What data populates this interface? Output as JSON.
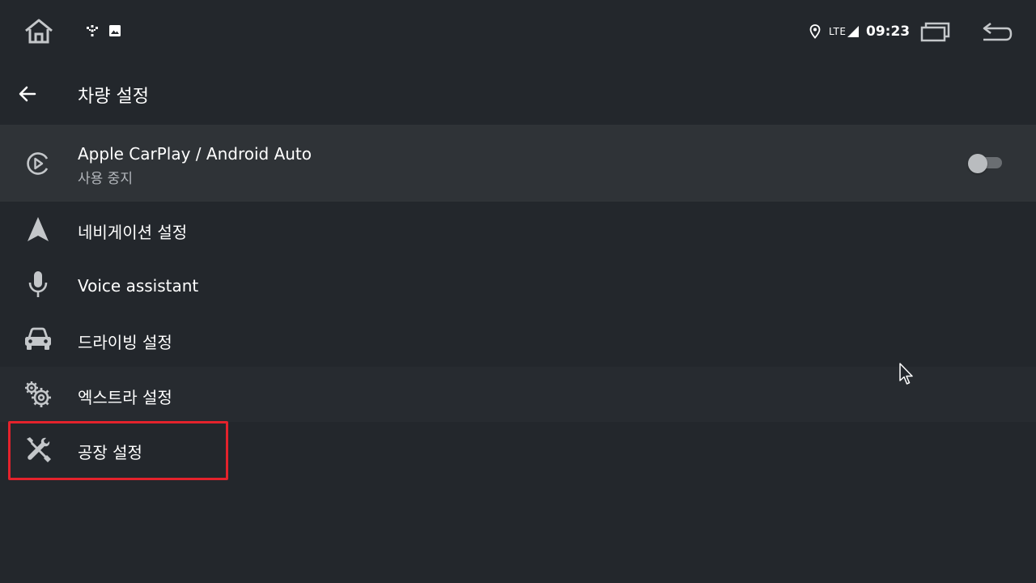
{
  "status_bar": {
    "network": "LTE",
    "time": "09:23",
    "icons": [
      "home-icon",
      "notification-app-icon",
      "notification-image-icon",
      "location-icon",
      "signal-icon",
      "recents-icon",
      "back-icon"
    ]
  },
  "app_bar": {
    "title": "차량 설정",
    "back_icon": "arrow-back-icon"
  },
  "settings": {
    "carplay": {
      "label": "Apple CarPlay / Android Auto",
      "status": "사용 중지",
      "icon": "play-circle-icon",
      "toggle_on": false
    },
    "navigation": {
      "label": "네비게이션 설정",
      "icon": "navigation-arrow-icon"
    },
    "voice": {
      "label": "Voice assistant",
      "icon": "microphone-icon"
    },
    "driving": {
      "label": "드라이빙 설정",
      "icon": "car-icon"
    },
    "extra": {
      "label": "엑스트라 설정",
      "icon": "gears-icon"
    },
    "factory": {
      "label": "공장 설정",
      "icon": "wrench-screwdriver-icon"
    }
  },
  "colors": {
    "background": "#23272c",
    "selected_row": "#2f3337",
    "hover_row": "#272b30",
    "icon": "#c4c7ca",
    "highlight": "#e4222c",
    "subtext": "#b3b7bc"
  }
}
